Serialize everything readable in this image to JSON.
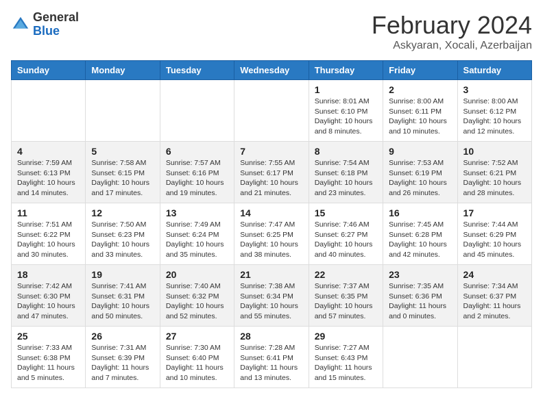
{
  "header": {
    "logo_line1": "General",
    "logo_line2": "Blue",
    "title": "February 2024",
    "subtitle": "Askyaran, Xocali, Azerbaijan"
  },
  "days_of_week": [
    "Sunday",
    "Monday",
    "Tuesday",
    "Wednesday",
    "Thursday",
    "Friday",
    "Saturday"
  ],
  "weeks": [
    [
      {
        "day": "",
        "info": ""
      },
      {
        "day": "",
        "info": ""
      },
      {
        "day": "",
        "info": ""
      },
      {
        "day": "",
        "info": ""
      },
      {
        "day": "1",
        "info": "Sunrise: 8:01 AM\nSunset: 6:10 PM\nDaylight: 10 hours\nand 8 minutes."
      },
      {
        "day": "2",
        "info": "Sunrise: 8:00 AM\nSunset: 6:11 PM\nDaylight: 10 hours\nand 10 minutes."
      },
      {
        "day": "3",
        "info": "Sunrise: 8:00 AM\nSunset: 6:12 PM\nDaylight: 10 hours\nand 12 minutes."
      }
    ],
    [
      {
        "day": "4",
        "info": "Sunrise: 7:59 AM\nSunset: 6:13 PM\nDaylight: 10 hours\nand 14 minutes."
      },
      {
        "day": "5",
        "info": "Sunrise: 7:58 AM\nSunset: 6:15 PM\nDaylight: 10 hours\nand 17 minutes."
      },
      {
        "day": "6",
        "info": "Sunrise: 7:57 AM\nSunset: 6:16 PM\nDaylight: 10 hours\nand 19 minutes."
      },
      {
        "day": "7",
        "info": "Sunrise: 7:55 AM\nSunset: 6:17 PM\nDaylight: 10 hours\nand 21 minutes."
      },
      {
        "day": "8",
        "info": "Sunrise: 7:54 AM\nSunset: 6:18 PM\nDaylight: 10 hours\nand 23 minutes."
      },
      {
        "day": "9",
        "info": "Sunrise: 7:53 AM\nSunset: 6:19 PM\nDaylight: 10 hours\nand 26 minutes."
      },
      {
        "day": "10",
        "info": "Sunrise: 7:52 AM\nSunset: 6:21 PM\nDaylight: 10 hours\nand 28 minutes."
      }
    ],
    [
      {
        "day": "11",
        "info": "Sunrise: 7:51 AM\nSunset: 6:22 PM\nDaylight: 10 hours\nand 30 minutes."
      },
      {
        "day": "12",
        "info": "Sunrise: 7:50 AM\nSunset: 6:23 PM\nDaylight: 10 hours\nand 33 minutes."
      },
      {
        "day": "13",
        "info": "Sunrise: 7:49 AM\nSunset: 6:24 PM\nDaylight: 10 hours\nand 35 minutes."
      },
      {
        "day": "14",
        "info": "Sunrise: 7:47 AM\nSunset: 6:25 PM\nDaylight: 10 hours\nand 38 minutes."
      },
      {
        "day": "15",
        "info": "Sunrise: 7:46 AM\nSunset: 6:27 PM\nDaylight: 10 hours\nand 40 minutes."
      },
      {
        "day": "16",
        "info": "Sunrise: 7:45 AM\nSunset: 6:28 PM\nDaylight: 10 hours\nand 42 minutes."
      },
      {
        "day": "17",
        "info": "Sunrise: 7:44 AM\nSunset: 6:29 PM\nDaylight: 10 hours\nand 45 minutes."
      }
    ],
    [
      {
        "day": "18",
        "info": "Sunrise: 7:42 AM\nSunset: 6:30 PM\nDaylight: 10 hours\nand 47 minutes."
      },
      {
        "day": "19",
        "info": "Sunrise: 7:41 AM\nSunset: 6:31 PM\nDaylight: 10 hours\nand 50 minutes."
      },
      {
        "day": "20",
        "info": "Sunrise: 7:40 AM\nSunset: 6:32 PM\nDaylight: 10 hours\nand 52 minutes."
      },
      {
        "day": "21",
        "info": "Sunrise: 7:38 AM\nSunset: 6:34 PM\nDaylight: 10 hours\nand 55 minutes."
      },
      {
        "day": "22",
        "info": "Sunrise: 7:37 AM\nSunset: 6:35 PM\nDaylight: 10 hours\nand 57 minutes."
      },
      {
        "day": "23",
        "info": "Sunrise: 7:35 AM\nSunset: 6:36 PM\nDaylight: 11 hours\nand 0 minutes."
      },
      {
        "day": "24",
        "info": "Sunrise: 7:34 AM\nSunset: 6:37 PM\nDaylight: 11 hours\nand 2 minutes."
      }
    ],
    [
      {
        "day": "25",
        "info": "Sunrise: 7:33 AM\nSunset: 6:38 PM\nDaylight: 11 hours\nand 5 minutes."
      },
      {
        "day": "26",
        "info": "Sunrise: 7:31 AM\nSunset: 6:39 PM\nDaylight: 11 hours\nand 7 minutes."
      },
      {
        "day": "27",
        "info": "Sunrise: 7:30 AM\nSunset: 6:40 PM\nDaylight: 11 hours\nand 10 minutes."
      },
      {
        "day": "28",
        "info": "Sunrise: 7:28 AM\nSunset: 6:41 PM\nDaylight: 11 hours\nand 13 minutes."
      },
      {
        "day": "29",
        "info": "Sunrise: 7:27 AM\nSunset: 6:43 PM\nDaylight: 11 hours\nand 15 minutes."
      },
      {
        "day": "",
        "info": ""
      },
      {
        "day": "",
        "info": ""
      }
    ]
  ]
}
